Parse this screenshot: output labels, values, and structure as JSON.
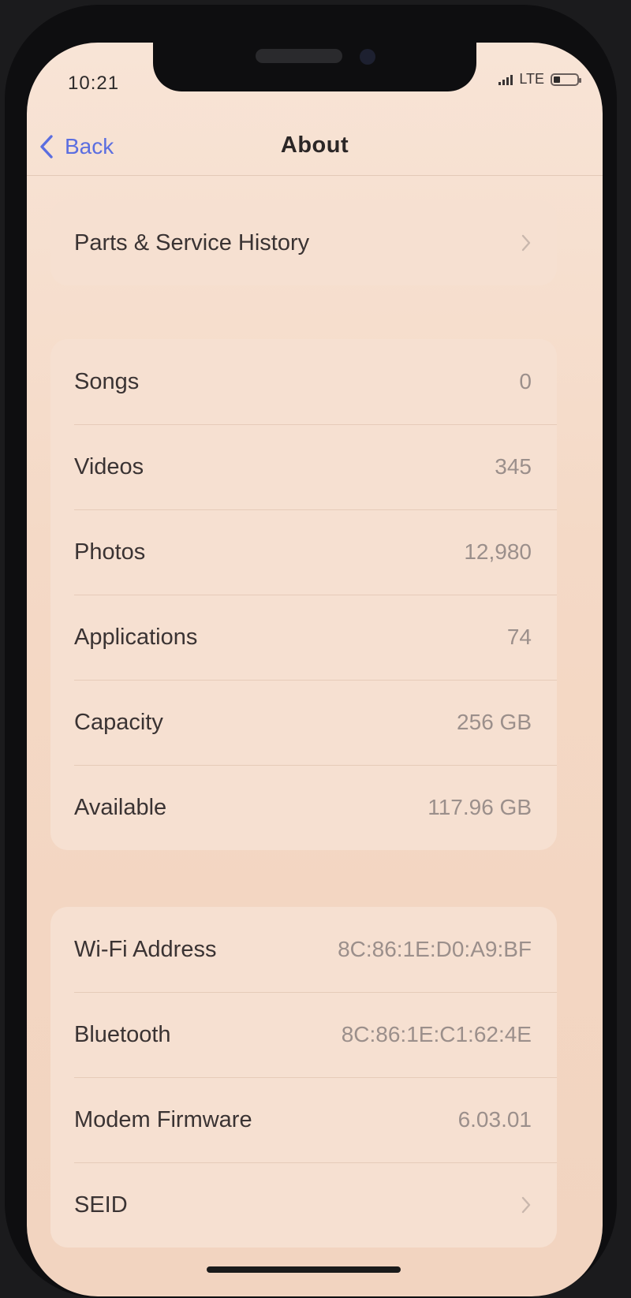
{
  "status_bar": {
    "time": "10:21",
    "network": "LTE"
  },
  "nav": {
    "back_label": "Back",
    "title": "About"
  },
  "sections": {
    "service": {
      "label": "Parts & Service History"
    },
    "media": [
      {
        "label": "Songs",
        "value": "0"
      },
      {
        "label": "Videos",
        "value": "345"
      },
      {
        "label": "Photos",
        "value": "12,980"
      },
      {
        "label": "Applications",
        "value": "74"
      },
      {
        "label": "Capacity",
        "value": "256 GB"
      },
      {
        "label": "Available",
        "value": "117.96 GB"
      }
    ],
    "network": [
      {
        "label": "Wi-Fi Address",
        "value": "8C:86:1E:D0:A9:BF"
      },
      {
        "label": "Bluetooth",
        "value": "8C:86:1E:C1:62:4E"
      },
      {
        "label": "Modem Firmware",
        "value": "6.03.01"
      },
      {
        "label": "SEID",
        "value": ""
      }
    ]
  },
  "colors": {
    "accent": "#5b6ee0",
    "background": "#f4d9c6",
    "group_background": "#f6e0d1"
  }
}
